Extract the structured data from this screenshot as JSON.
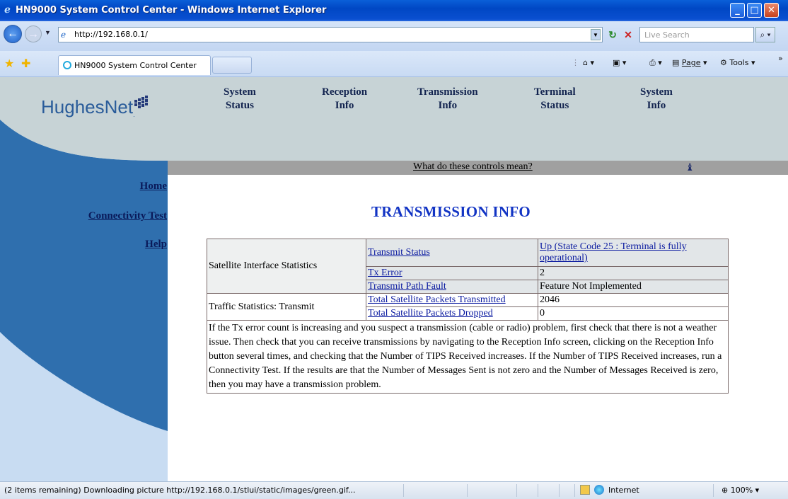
{
  "window": {
    "title": "HN9000 System Control Center - Windows Internet Explorer"
  },
  "addressbar": {
    "url": "http://192.168.0.1/",
    "search_placeholder": "Live Search"
  },
  "tabs": [
    {
      "label": "HN9000 System Control Center"
    }
  ],
  "command_bar": {
    "page_label": "Page",
    "tools_label": "Tools"
  },
  "logo": {
    "text": "HughesNet",
    "tm": "."
  },
  "topnav": [
    {
      "line1": "System",
      "line2": "Status"
    },
    {
      "line1": "Reception",
      "line2": "Info"
    },
    {
      "line1": "Transmission",
      "line2": "Info"
    },
    {
      "line1": "Terminal",
      "line2": "Status"
    },
    {
      "line1": "System",
      "line2": "Info"
    }
  ],
  "help_bar": {
    "link": "What do these controls mean?"
  },
  "sidebar": {
    "items": [
      {
        "label": "Home"
      },
      {
        "label": "Connectivity Test"
      },
      {
        "label": "Help"
      }
    ]
  },
  "page": {
    "title": "TRANSMISSION INFO"
  },
  "table": {
    "groups": [
      {
        "name": "Satellite Interface Statistics",
        "rows": [
          {
            "label": "Transmit Status",
            "value": "Up (State Code 25 : Terminal is fully operational)",
            "value_link": true
          },
          {
            "label": "Tx Error",
            "value": "2",
            "value_link": false
          },
          {
            "label": "Transmit Path Fault",
            "value": "Feature Not Implemented",
            "value_link": false
          }
        ]
      },
      {
        "name": "Traffic Statistics: Transmit",
        "rows": [
          {
            "label": "Total Satellite Packets Transmitted",
            "value": "2046",
            "value_link": false
          },
          {
            "label": "Total Satellite Packets Dropped",
            "value": "0",
            "value_link": false
          }
        ]
      }
    ],
    "note": "If the Tx error count is increasing and you suspect a transmission (cable or radio) problem, first check that there is not a weather issue. Then check that you can receive transmissions by navigating to the Reception Info screen, clicking on the Reception Info button several times, and checking that the Number of TIPS Received increases. If the Number of TIPS Received increases, run a Connectivity Test. If the results are that the Number of Messages Sent is not zero and the Number of Messages Received is zero, then you may have a transmission problem."
  },
  "statusbar": {
    "text": "(2 items remaining) Downloading picture http://192.168.0.1/stlui/static/images/green.gif...",
    "zone": "Internet",
    "zoom": "100%"
  },
  "colors": {
    "sidebar_blue": "#2f6fae",
    "sidebar_light": "#c8dcf2",
    "header_gray": "#c7d3d6",
    "title_blue": "#1234c4"
  }
}
